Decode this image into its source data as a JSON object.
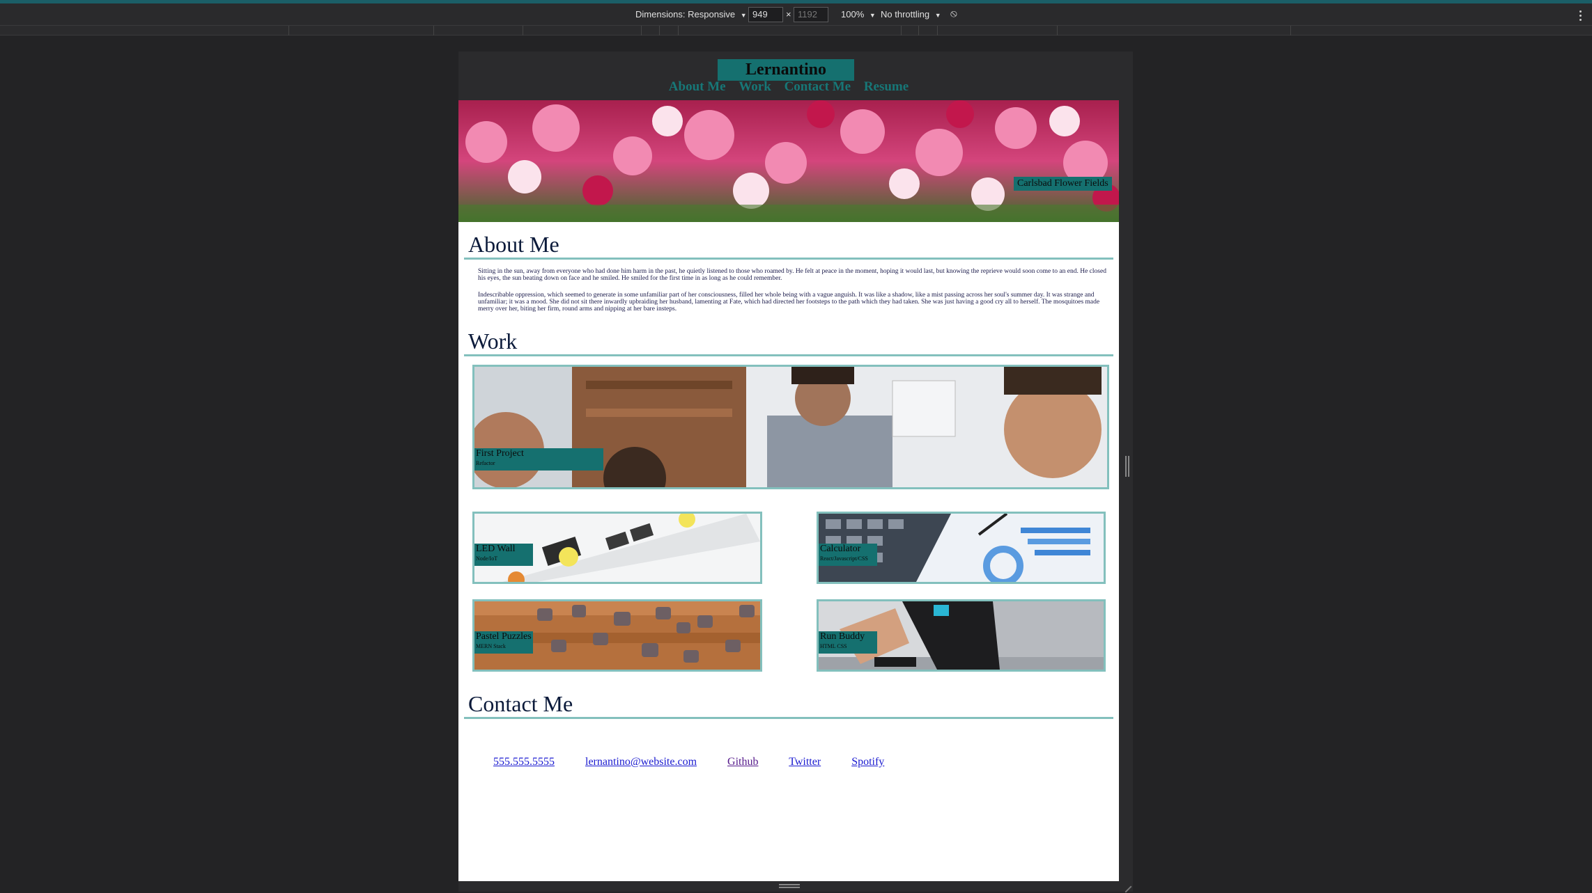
{
  "devtools": {
    "dimensions_label": "Dimensions: Responsive",
    "width_value": "949",
    "times": "×",
    "height_value": "1192",
    "zoom": "100%",
    "throttle": "No throttling"
  },
  "site": {
    "brand": "Lernantino",
    "nav": [
      "About Me",
      "Work",
      "Contact Me",
      "Resume"
    ],
    "hero_caption": "Carlsbad Flower Fields",
    "about": {
      "heading": "About Me",
      "p1": "Sitting in the sun, away from everyone who had done him harm in the past, he quietly listened to those who roamed by. He felt at peace in the moment, hoping it would last, but knowing the reprieve would soon come to an end. He closed his eyes, the sun beating down on face and he smiled. He smiled for the first time in as long as he could remember.",
      "p2": "Indescribable oppression, which seemed to generate in some unfamiliar part of her consciousness, filled her whole being with a vague anguish. It was like a shadow, like a mist passing across her soul's summer day. It was strange and unfamiliar; it was a mood. She did not sit there inwardly upbraiding her husband, lamenting at Fate, which had directed her footsteps to the path which they had taken. She was just having a good cry all to herself. The mosquitoes made merry over her, biting her firm, round arms and nipping at her bare insteps."
    },
    "work": {
      "heading": "Work",
      "projects": [
        {
          "title": "First Project",
          "sub": "Refactor"
        },
        {
          "title": "LED Wall",
          "sub": "Node/IoT"
        },
        {
          "title": "Calculator",
          "sub": "React/Javascript/CSS"
        },
        {
          "title": "Pastel Puzzles",
          "sub": "MERN Stack"
        },
        {
          "title": "Run Buddy",
          "sub": "HTML CSS"
        }
      ]
    },
    "contact": {
      "heading": "Contact Me",
      "links": [
        "555.555.5555",
        "lernantino@website.com",
        "Github",
        "Twitter",
        "Spotify"
      ]
    }
  }
}
